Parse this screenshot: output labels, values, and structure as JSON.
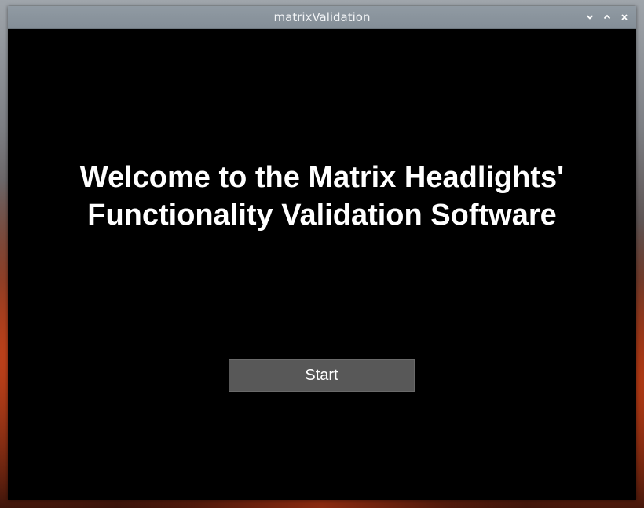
{
  "window": {
    "title": "matrixValidation",
    "controls": [
      {
        "name": "minimize",
        "icon": "chevron-down-icon"
      },
      {
        "name": "maximize",
        "icon": "chevron-up-icon"
      },
      {
        "name": "close",
        "icon": "close-icon"
      }
    ]
  },
  "main": {
    "welcome_line1": "Welcome to the Matrix Headlights'",
    "welcome_line2": "Functionality Validation Software",
    "start_label": "Start"
  },
  "colors": {
    "titlebar": "#8a949d",
    "window_bg": "#000000",
    "button_bg": "#585858",
    "text": "#ffffff"
  }
}
